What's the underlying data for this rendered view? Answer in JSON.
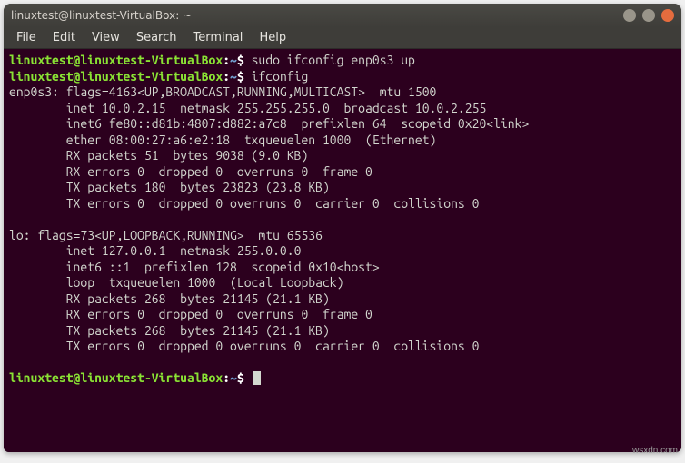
{
  "window": {
    "title": "linuxtest@linuxtest-VirtualBox: ~"
  },
  "menubar": {
    "items": [
      "File",
      "Edit",
      "View",
      "Search",
      "Terminal",
      "Help"
    ]
  },
  "prompt": {
    "user_host": "linuxtest@linuxtest-VirtualBox",
    "separator": ":",
    "path": "~",
    "suffix": "$"
  },
  "commands": {
    "c1": "sudo ifconfig enp0s3 up",
    "c2": "ifconfig"
  },
  "output": {
    "enp0s3": [
      "enp0s3: flags=4163<UP,BROADCAST,RUNNING,MULTICAST>  mtu 1500",
      "        inet 10.0.2.15  netmask 255.255.255.0  broadcast 10.0.2.255",
      "        inet6 fe80::d81b:4807:d882:a7c8  prefixlen 64  scopeid 0x20<link>",
      "        ether 08:00:27:a6:e2:18  txqueuelen 1000  (Ethernet)",
      "        RX packets 51  bytes 9038 (9.0 KB)",
      "        RX errors 0  dropped 0  overruns 0  frame 0",
      "        TX packets 180  bytes 23823 (23.8 KB)",
      "        TX errors 0  dropped 0 overruns 0  carrier 0  collisions 0"
    ],
    "lo": [
      "lo: flags=73<UP,LOOPBACK,RUNNING>  mtu 65536",
      "        inet 127.0.0.1  netmask 255.0.0.0",
      "        inet6 ::1  prefixlen 128  scopeid 0x10<host>",
      "        loop  txqueuelen 1000  (Local Loopback)",
      "        RX packets 268  bytes 21145 (21.1 KB)",
      "        RX errors 0  dropped 0  overruns 0  frame 0",
      "        TX packets 268  bytes 21145 (21.1 KB)",
      "        TX errors 0  dropped 0 overruns 0  carrier 0  collisions 0"
    ]
  },
  "watermark": "wsxdn.com"
}
